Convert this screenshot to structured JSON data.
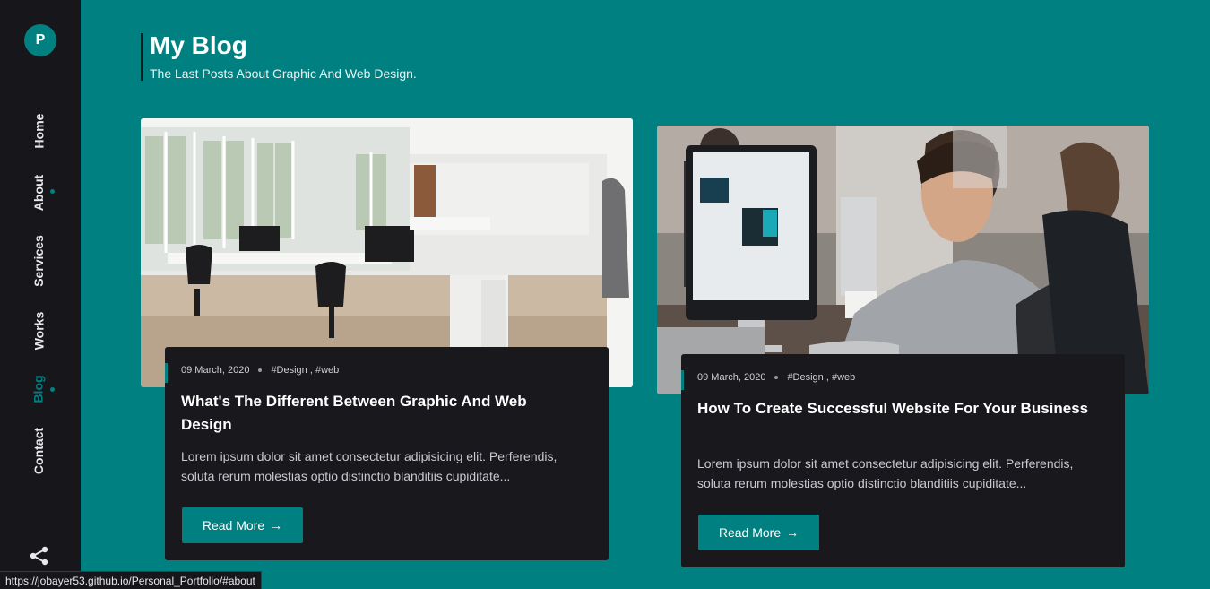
{
  "brand": {
    "logo_letter": "P"
  },
  "nav": {
    "items": [
      {
        "label": "Home"
      },
      {
        "label": "About"
      },
      {
        "label": "Services"
      },
      {
        "label": "Works"
      },
      {
        "label": "Blog"
      },
      {
        "label": "Contact"
      }
    ],
    "active": "Blog"
  },
  "header": {
    "title": "My Blog",
    "subtitle": "The Last Posts About Graphic And Web Design."
  },
  "posts": [
    {
      "date": "09 March, 2020",
      "tags": "#Design , #web",
      "title": "What's The Different Between Graphic And Web Design",
      "excerpt": "Lorem ipsum dolor sit amet consectetur adipisicing elit. Perferendis, soluta rerum molestias optio distinctio blanditiis cupiditate...",
      "button": "Read More",
      "image": "office-interior-photo"
    },
    {
      "date": "09 March, 2020",
      "tags": "#Design , #web",
      "title": "How To Create Successful Website For Your Business",
      "excerpt": "Lorem ipsum dolor sit amet consectetur adipisicing elit. Perferendis, soluta rerum molestias optio distinctio blanditiis cupiditate...",
      "button": "Read More",
      "image": "man-at-computer-photo"
    }
  ],
  "status_bar": {
    "url": "https://jobayer53.github.io/Personal_Portfolio/#about"
  },
  "colors": {
    "accent": "#008080",
    "dark": "#16161b",
    "card": "#18181d"
  }
}
